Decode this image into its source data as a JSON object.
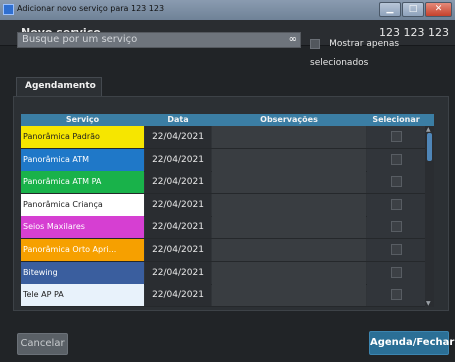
{
  "window": {
    "title": "Adicionar novo serviço para 123 123",
    "minimize_icon": "minimize-icon",
    "maximize_icon": "maximize-icon",
    "close_icon": "close-icon"
  },
  "header": {
    "title": "Novo serviço",
    "user": "123 123 123"
  },
  "search": {
    "placeholder": "Busque por um serviço",
    "icon": "binoculars-icon",
    "show_selected_label": "Mostrar apenas selecionados"
  },
  "tabs": [
    {
      "label": "Agendamento"
    }
  ],
  "table": {
    "headers": [
      "Serviço",
      "Data",
      "Observações",
      "Selecionar"
    ],
    "rows": [
      {
        "service": "Panorâmica Padrão",
        "date": "22/04/2021",
        "color": "#f6e600",
        "text_color": "#1e1e1e"
      },
      {
        "service": "Panorâmica ATM",
        "date": "22/04/2021",
        "color": "#1f78c8",
        "text_color": "#ffffff"
      },
      {
        "service": "Panorâmica ATM PA",
        "date": "22/04/2021",
        "color": "#19b24a",
        "text_color": "#ffffff"
      },
      {
        "service": "Panorâmica Criança",
        "date": "22/04/2021",
        "color": "#ffffff",
        "text_color": "#1e1e1e"
      },
      {
        "service": "Seios Maxilares",
        "date": "22/04/2021",
        "color": "#d63fd2",
        "text_color": "#ffffff"
      },
      {
        "service": "Panorâmica Orto Apri...",
        "date": "22/04/2021",
        "color": "#f6a000",
        "text_color": "#ffffff"
      },
      {
        "service": "Bitewing",
        "date": "22/04/2021",
        "color": "#3a5e9e",
        "text_color": "#ffffff"
      },
      {
        "service": "Tele AP PA",
        "date": "22/04/2021",
        "color": "#e8f2fb",
        "text_color": "#1e1e1e"
      }
    ]
  },
  "buttons": {
    "cancel": "Cancelar",
    "schedule": "Agenda/Fechar"
  },
  "colors": {
    "accent": "#3b7ea4",
    "button_primary": "#2b6f96"
  }
}
